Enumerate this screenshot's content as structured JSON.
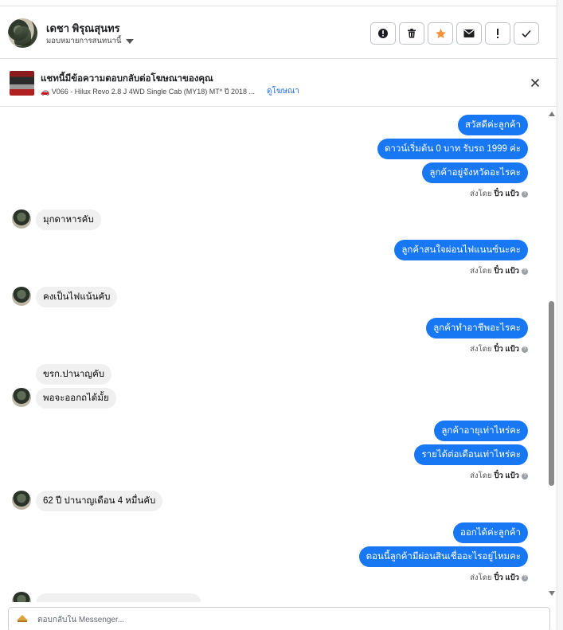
{
  "header": {
    "contact_name": "เดชา พิรุณสุนทร",
    "assign_label": "มอบหมายการสนทนานี้",
    "actions": [
      "spam",
      "delete",
      "star",
      "mark-unread",
      "follow-up",
      "done"
    ]
  },
  "ad_banner": {
    "title": "แชทนี้มีข้อความตอบกลับต่อโฆษณาของคุณ",
    "subtitle": "🚗 V066 - Hilux Revo 2.8 J 4WD Single Cab (MY18) MT* ปี 2018 ...",
    "link": "ดูโฆษณา"
  },
  "messages": {
    "m1": "สวัสดีค่ะลูกค้า",
    "m2": "ดาวน์เริ่มต้น 0 บาท รับรถ 1999 ค่ะ",
    "m3": "ลูกค้าอยู่จังหวัดอะไรคะ",
    "m4": "มุกดาหารคับ",
    "m5": "ลูกค้าสนใจผ่อนไฟแนนซ์นะคะ",
    "m6": "คงเป็นไฟแน้นคับ",
    "m7": "ลูกค้าทำอาชีพอะไรคะ",
    "m8": "ขรก.ปานาญคับ",
    "m9": "พอจะออกถได้มั้ย",
    "m10": "ลูกค้าอายุเท่าไหร่คะ",
    "m11": "รายได้ต่อเดือนเท่าไหร่คะ",
    "m12": "62 ปี ปานาญเดือน 4 หมื่นคับ",
    "m13": "ออกได้ค่ะลูกค้า",
    "m14": "ตอนนี้ลูกค้ามีผ่อนสินเชื่ออะไรอยู่ไหมคะ"
  },
  "sent_by": {
    "prefix": "ส่งโดย",
    "name": "ปิ๋ว แป้ว"
  },
  "composer": {
    "placeholder": "ตอบกลับใน Messenger..."
  },
  "colors": {
    "outgoing_bubble": "#1877f2",
    "incoming_bubble": "#f0f0f0",
    "star": "#f7923a"
  }
}
